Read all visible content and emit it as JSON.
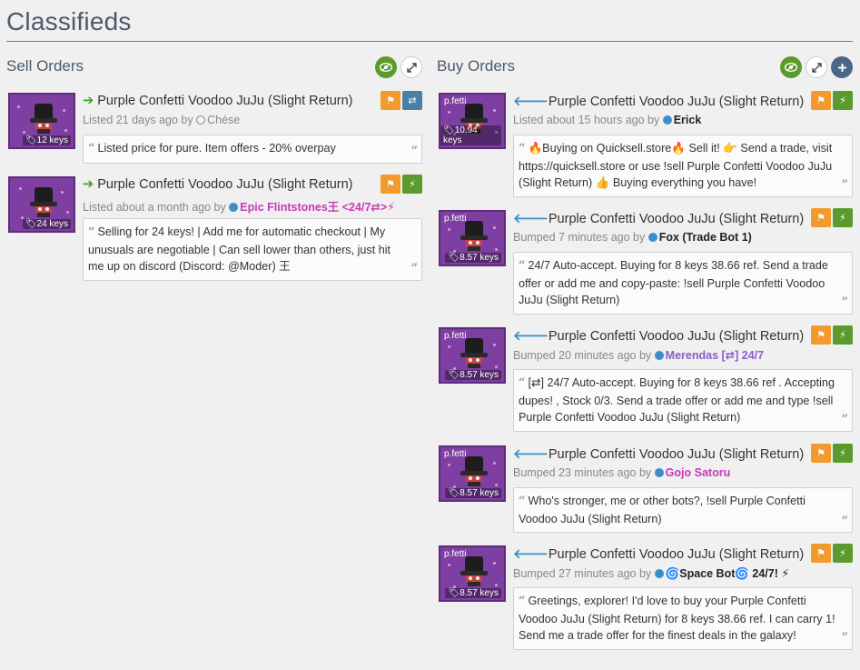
{
  "page": {
    "title": "Classifieds"
  },
  "sell": {
    "title": "Sell Orders",
    "listings": [
      {
        "item": "Purple Confetti Voodoo JuJu (Slight Return)",
        "price": "12 keys",
        "time": "Listed 21 days ago by",
        "user": "Chése",
        "comment": "Listed price for pure. Item offers - 20% overpay"
      },
      {
        "item": "Purple Confetti Voodoo JuJu (Slight Return)",
        "price": "24 keys",
        "time": "Listed about a month ago by",
        "user": "Epic Flintstones王 <24/7⇄>⚡",
        "comment": "Selling for 24 keys! | Add me for automatic checkout | My unusuals are negotiable | Can sell lower than others, just hit me up on discord (Discord: @Moder) 王"
      }
    ]
  },
  "buy": {
    "title": "Buy Orders",
    "listings": [
      {
        "item": "Purple Confetti Voodoo JuJu (Slight Return)",
        "price": "10.94 keys",
        "thumb_label": "p.fetti",
        "time": "Listed about 15 hours ago by",
        "user": "Erick",
        "comment": "🔥Buying on Quicksell.store🔥 Sell it! 👉 Send a trade, visit https://quicksell.store or use !sell Purple Confetti Voodoo JuJu (Slight Return) 👍 Buying everything you have!"
      },
      {
        "item": "Purple Confetti Voodoo JuJu (Slight Return)",
        "price": "8.57 keys",
        "thumb_label": "p.fetti",
        "time": "Bumped 7 minutes ago by",
        "user": "Fox (Trade Bot 1)",
        "comment": "24/7 Auto-accept. Buying for 8 keys 38.66 ref. Send a trade offer or add me and copy-paste: !sell Purple Confetti Voodoo JuJu (Slight Return)"
      },
      {
        "item": "Purple Confetti Voodoo JuJu (Slight Return)",
        "price": "8.57 keys",
        "thumb_label": "p.fetti",
        "time": "Bumped 20 minutes ago by",
        "user": "Merendas [⇄] 24/7",
        "comment": "[⇄] 24/7 Auto-accept. Buying for 8 keys 38.66 ref . Accepting dupes! , Stock 0/3. Send a trade offer or add me and type !sell Purple Confetti Voodoo JuJu (Slight Return)"
      },
      {
        "item": "Purple Confetti Voodoo JuJu (Slight Return)",
        "price": "8.57 keys",
        "thumb_label": "p.fetti",
        "time": "Bumped 23 minutes ago by",
        "user": "Gojo Satoru",
        "comment": "Who's stronger, me or other bots?, !sell Purple Confetti Voodoo JuJu (Slight Return)"
      },
      {
        "item": "Purple Confetti Voodoo JuJu (Slight Return)",
        "price": "8.57 keys",
        "thumb_label": "p.fetti",
        "time": "Bumped 27 minutes ago by",
        "user": "🌀Space Bot🌀 24/7! ⚡",
        "comment": "Greetings, explorer! I'd love to buy your Purple Confetti Voodoo JuJu (Slight Return) for 8 keys 38.66 ref. I can carry 1! Send me a trade offer for the finest deals in the galaxy!"
      }
    ]
  },
  "colors": {
    "accent_green": "#5b9a2c",
    "accent_orange": "#f39a2d",
    "accent_blue": "#4a6785",
    "thumb_purple": "#7d3fa1",
    "username_pink": "#c838b8",
    "username_purple": "#8d5cc7"
  },
  "icons": {
    "visibility": "eye-icon",
    "expand": "expand-icon",
    "add": "plus-icon",
    "report": "flag-icon",
    "swap": "swap-icon",
    "instant": "lightning-icon",
    "price_tag": "tag-icon"
  }
}
